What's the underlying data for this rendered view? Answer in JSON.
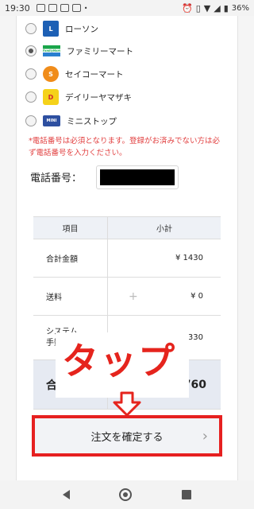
{
  "status_bar": {
    "time": "19:30",
    "battery": "36%"
  },
  "stores": [
    {
      "name": "ローソン",
      "selected": false,
      "logo_text": "L"
    },
    {
      "name": "ファミリーマート",
      "selected": true,
      "logo_text": "FamilyMart"
    },
    {
      "name": "セイコーマート",
      "selected": false,
      "logo_text": "S"
    },
    {
      "name": "デイリーヤマザキ",
      "selected": false,
      "logo_text": "D"
    },
    {
      "name": "ミニストップ",
      "selected": false,
      "logo_text": "MINI"
    }
  ],
  "notice": "*電話番号は必須となります。登録がお済みでない方は必ず電話番号を入力ください。",
  "phone": {
    "label": "電話番号："
  },
  "table": {
    "header": {
      "item": "項目",
      "subtotal": "小計"
    },
    "rows": [
      {
        "label": "合計金額",
        "value": "¥ 1430"
      },
      {
        "label": "送料",
        "plus": "+",
        "value": "¥ 0"
      },
      {
        "label": "システム手数料",
        "plus": "+",
        "value": "¥ 330"
      }
    ],
    "total": {
      "label": "合計",
      "value": ",760"
    }
  },
  "overlay": {
    "text": "タップ"
  },
  "confirm_button": {
    "label": "注文を確定する",
    "chevron": "›"
  },
  "colors": {
    "accent_red": "#e5241d",
    "notice_red": "#e24040"
  }
}
